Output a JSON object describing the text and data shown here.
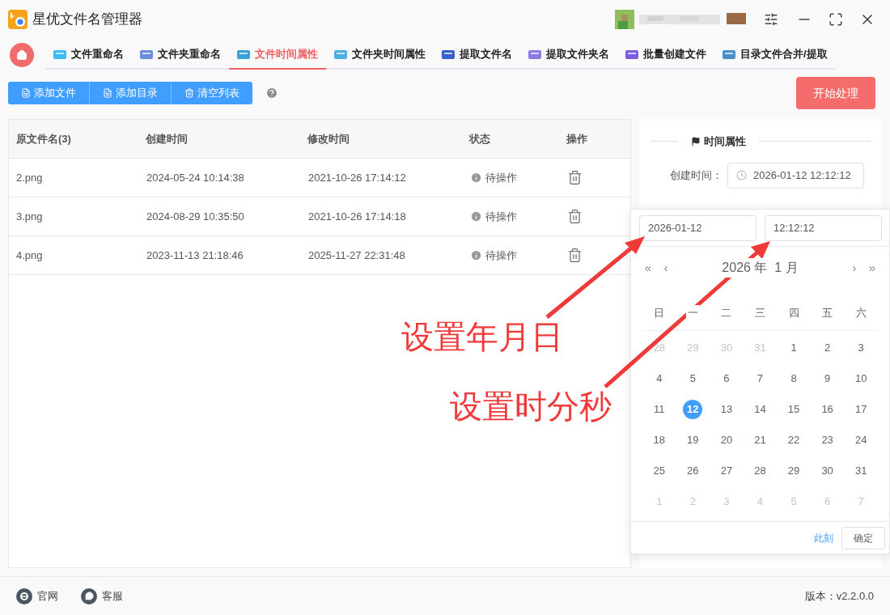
{
  "window": {
    "title": "星优文件名管理器"
  },
  "tabs": [
    {
      "label": "文件重命名",
      "selected": false
    },
    {
      "label": "文件夹重命名",
      "selected": false
    },
    {
      "label": "文件时间属性",
      "selected": true
    },
    {
      "label": "文件夹时间属性",
      "selected": false
    },
    {
      "label": "提取文件名",
      "selected": false
    },
    {
      "label": "提取文件夹名",
      "selected": false
    },
    {
      "label": "批量创建文件",
      "selected": false
    },
    {
      "label": "目录文件合并/提取",
      "selected": false
    }
  ],
  "toolbar": {
    "buttons": [
      "添加文件",
      "添加目录",
      "清空列表"
    ],
    "start_button": "开始处理"
  },
  "table": {
    "columns": [
      "原文件名(3)",
      "创建时间",
      "修改时间",
      "状态",
      "操作"
    ],
    "rows": [
      {
        "name": "2.png",
        "created": "2024-05-24 10:14:38",
        "modified": "2021-10-26 17:14:12",
        "status": "待操作"
      },
      {
        "name": "3.png",
        "created": "2024-08-29 10:35:50",
        "modified": "2021-10-26 17:14:18",
        "status": "待操作"
      },
      {
        "name": "4.png",
        "created": "2023-11-13 21:18:46",
        "modified": "2025-11-27 22:31:48",
        "status": "待操作"
      }
    ]
  },
  "side_panel": {
    "title": "时间属性",
    "label": "创建时间：",
    "value": "2026-01-12 12:12:12"
  },
  "picker": {
    "date_value": "2026-01-12",
    "time_value": "12:12:12",
    "nav": [
      "«",
      "‹",
      "›",
      "»"
    ],
    "month_title": "2026 年  1 月",
    "weekdays": [
      "日",
      "一",
      "二",
      "三",
      "四",
      "五",
      "六"
    ],
    "days": [
      {
        "text": "28",
        "muted": true,
        "selected": false
      },
      {
        "text": "29",
        "muted": true,
        "selected": false
      },
      {
        "text": "30",
        "muted": true,
        "selected": false
      },
      {
        "text": "31",
        "muted": true,
        "selected": false
      },
      {
        "text": "1",
        "muted": false,
        "selected": false
      },
      {
        "text": "2",
        "muted": false,
        "selected": false
      },
      {
        "text": "3",
        "muted": false,
        "selected": false
      },
      {
        "text": "4",
        "muted": false,
        "selected": false
      },
      {
        "text": "5",
        "muted": false,
        "selected": false
      },
      {
        "text": "6",
        "muted": false,
        "selected": false
      },
      {
        "text": "7",
        "muted": false,
        "selected": false
      },
      {
        "text": "8",
        "muted": false,
        "selected": false
      },
      {
        "text": "9",
        "muted": false,
        "selected": false
      },
      {
        "text": "10",
        "muted": false,
        "selected": false
      },
      {
        "text": "11",
        "muted": false,
        "selected": false
      },
      {
        "text": "12",
        "muted": false,
        "selected": true
      },
      {
        "text": "13",
        "muted": false,
        "selected": false
      },
      {
        "text": "14",
        "muted": false,
        "selected": false
      },
      {
        "text": "15",
        "muted": false,
        "selected": false
      },
      {
        "text": "16",
        "muted": false,
        "selected": false
      },
      {
        "text": "17",
        "muted": false,
        "selected": false
      },
      {
        "text": "18",
        "muted": false,
        "selected": false
      },
      {
        "text": "19",
        "muted": false,
        "selected": false
      },
      {
        "text": "20",
        "muted": false,
        "selected": false
      },
      {
        "text": "21",
        "muted": false,
        "selected": false
      },
      {
        "text": "22",
        "muted": false,
        "selected": false
      },
      {
        "text": "23",
        "muted": false,
        "selected": false
      },
      {
        "text": "24",
        "muted": false,
        "selected": false
      },
      {
        "text": "25",
        "muted": false,
        "selected": false
      },
      {
        "text": "26",
        "muted": false,
        "selected": false
      },
      {
        "text": "27",
        "muted": false,
        "selected": false
      },
      {
        "text": "28",
        "muted": false,
        "selected": false
      },
      {
        "text": "29",
        "muted": false,
        "selected": false
      },
      {
        "text": "30",
        "muted": false,
        "selected": false
      },
      {
        "text": "31",
        "muted": false,
        "selected": false
      },
      {
        "text": "1",
        "muted": true,
        "selected": false
      },
      {
        "text": "2",
        "muted": true,
        "selected": false
      },
      {
        "text": "3",
        "muted": true,
        "selected": false
      },
      {
        "text": "4",
        "muted": true,
        "selected": false
      },
      {
        "text": "5",
        "muted": true,
        "selected": false
      },
      {
        "text": "6",
        "muted": true,
        "selected": false
      },
      {
        "text": "7",
        "muted": true,
        "selected": false
      }
    ],
    "now_link": "此刻",
    "ok_button": "确定"
  },
  "annotations": [
    "设置年月日",
    "设置时分秒"
  ],
  "footer": {
    "links": [
      "官网",
      "客服"
    ],
    "version": "版本：v2.2.0.0"
  }
}
